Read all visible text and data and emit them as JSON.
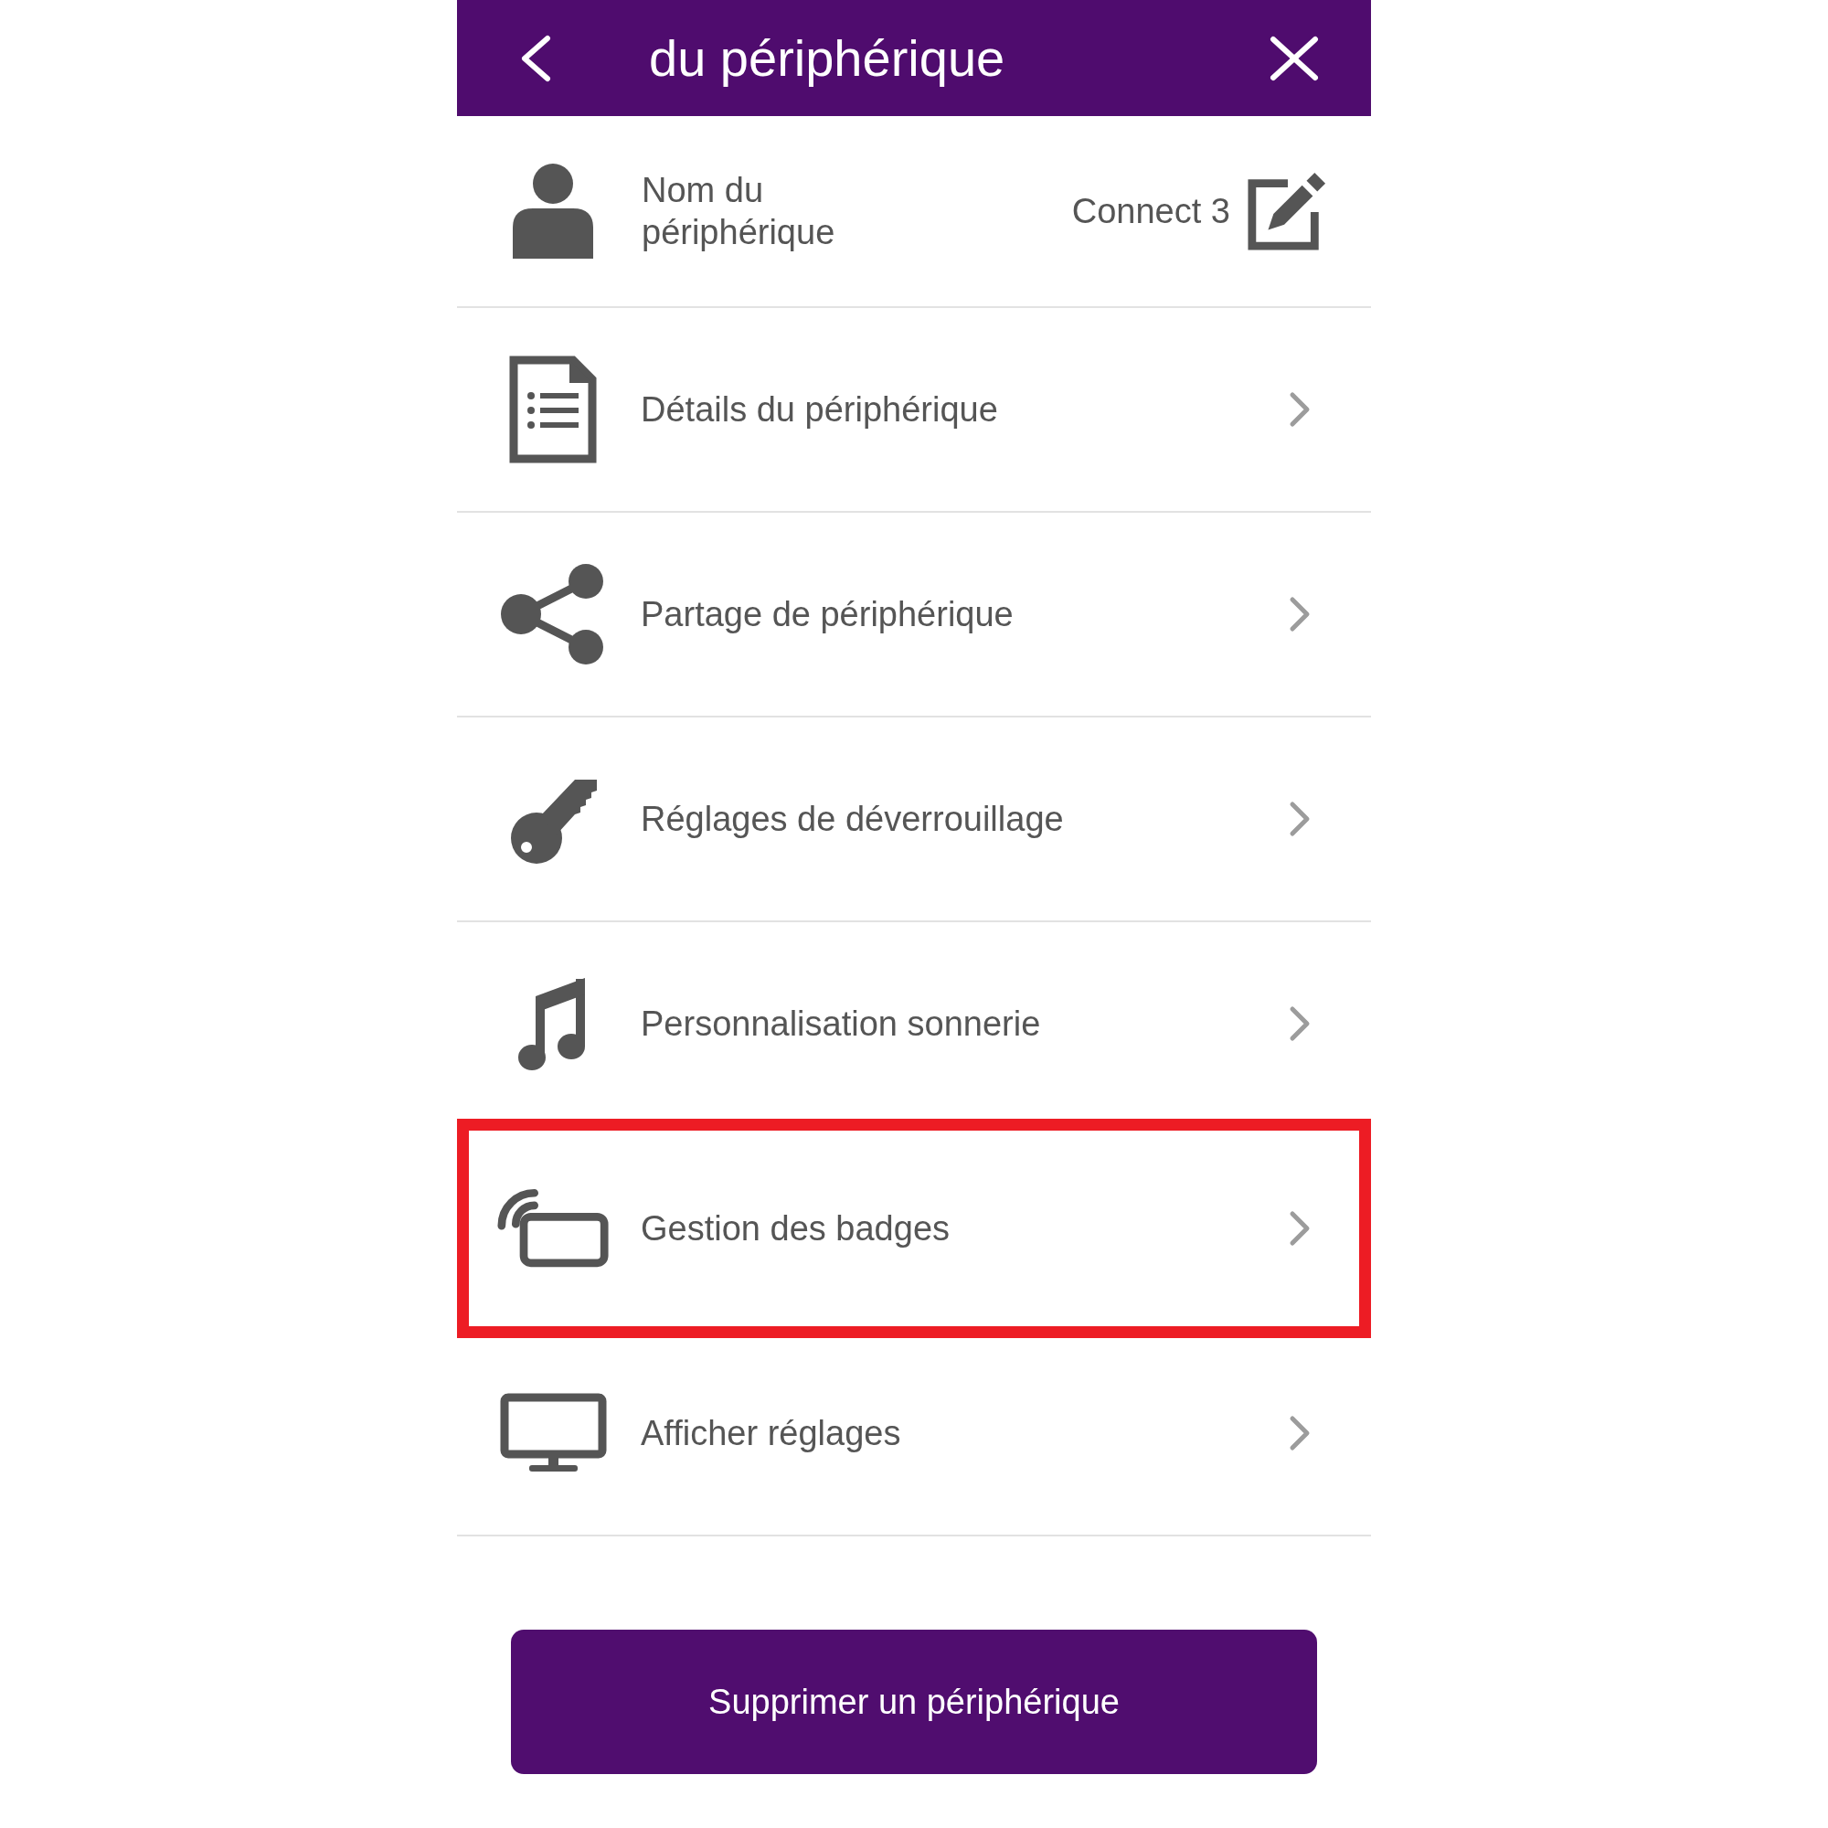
{
  "header": {
    "title": "du périphérique"
  },
  "device_name": {
    "label": "Nom du périphérique",
    "value": "Connect 3"
  },
  "menu_items": [
    {
      "label": "Détails du périphérique",
      "highlighted": false
    },
    {
      "label": "Partage de périphérique",
      "highlighted": false
    },
    {
      "label": "Réglages de déverrouillage",
      "highlighted": false
    },
    {
      "label": "Personnalisation sonnerie",
      "highlighted": false
    },
    {
      "label": "Gestion des badges",
      "highlighted": true
    },
    {
      "label": "Afficher réglages",
      "highlighted": false
    }
  ],
  "delete_button": {
    "label": "Supprimer un périphérique"
  }
}
